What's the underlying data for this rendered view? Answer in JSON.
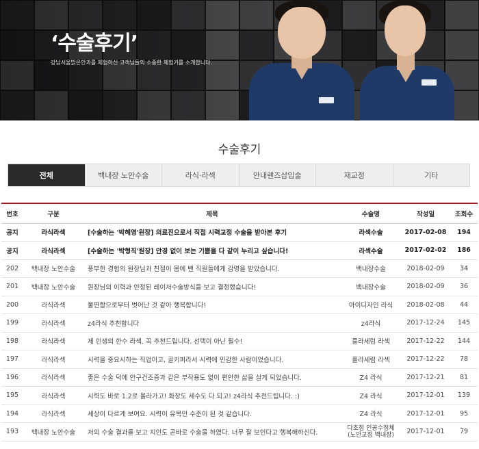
{
  "banner": {
    "title": "‘수술후기’",
    "subtitle": "강남서울밝은안과를 체험하신 고객님들의 소중한 체험기를 소개합니다."
  },
  "page_title": "수술후기",
  "tabs": [
    {
      "label": "전체",
      "active": true
    },
    {
      "label": "백내장 노안수술",
      "active": false
    },
    {
      "label": "라식·라섹",
      "active": false
    },
    {
      "label": "안내렌즈삽입술",
      "active": false
    },
    {
      "label": "재교정",
      "active": false
    },
    {
      "label": "기타",
      "active": false
    }
  ],
  "table": {
    "headers": {
      "no": "번호",
      "category": "구분",
      "title": "제목",
      "surgery": "수술명",
      "date": "작성일",
      "views": "조회수"
    },
    "rows": [
      {
        "no": "공지",
        "category": "라식라섹",
        "title": "[수술하는 '박혜영'원장] 의료진으로서 직접 시력교정 수술을 받아본 후기",
        "surgery": "라섹수술",
        "surgery2": "",
        "date": "2017-02-08",
        "views": "194",
        "notice": true
      },
      {
        "no": "공지",
        "category": "라식라섹",
        "title": "[수술하는 '박형직'원장] 안경 없이 보는 기쁨을 다 같이 누리고 싶습니다!",
        "surgery": "라섹수술",
        "surgery2": "",
        "date": "2017-02-02",
        "views": "186",
        "notice": true
      },
      {
        "no": "202",
        "category": "백내장 노안수술",
        "title": "풍부한 경험의 원장님과 친절이 몸에 밴 직원들에게 감명을 받았습니다.",
        "surgery": "백내장수술",
        "surgery2": "",
        "date": "2018-02-09",
        "views": "34",
        "notice": false
      },
      {
        "no": "201",
        "category": "백내장 노안수술",
        "title": "원장님의 이력과 안정된 레이저수술방식을 보고 결정했습니다!",
        "surgery": "백내장수술",
        "surgery2": "",
        "date": "2018-02-09",
        "views": "36",
        "notice": false
      },
      {
        "no": "200",
        "category": "라식라섹",
        "title": "불편함으로부터 벗어난 것 같아 행복합니다!",
        "surgery": "아이디자인 라식",
        "surgery2": "",
        "date": "2018-02-08",
        "views": "44",
        "notice": false
      },
      {
        "no": "199",
        "category": "라식라섹",
        "title": "z4라식 추천합니다",
        "surgery": "z4라식",
        "surgery2": "",
        "date": "2017-12-24",
        "views": "145",
        "notice": false
      },
      {
        "no": "198",
        "category": "라식라섹",
        "title": "제 인생의 한수 라섹. 꼭 추천드립니다. 선택이 아닌 필수!",
        "surgery": "플라세럼 라섹",
        "surgery2": "",
        "date": "2017-12-22",
        "views": "144",
        "notice": false
      },
      {
        "no": "197",
        "category": "라식라섹",
        "title": "시력을 중요시하는 직업이고, 골키퍼라서 시력에 민감한 사람이었습니다.",
        "surgery": "플라세럼 라섹",
        "surgery2": "",
        "date": "2017-12-22",
        "views": "78",
        "notice": false
      },
      {
        "no": "196",
        "category": "라식라섹",
        "title": "좋은 수술 덕에 안구건조증과 같은 부작용도 없이 편안한 삶을 살게 되었습니다.",
        "surgery": "Z4 라식",
        "surgery2": "",
        "date": "2017-12-21",
        "views": "81",
        "notice": false
      },
      {
        "no": "195",
        "category": "라식라섹",
        "title": "시력도 바로 1.2로 올라가고! 화장도 세수도 다 되고! z4라식 추천드립니다. :)",
        "surgery": "Z4 라식",
        "surgery2": "",
        "date": "2017-12-01",
        "views": "139",
        "notice": false
      },
      {
        "no": "194",
        "category": "라식라섹",
        "title": "세상이 다르게 보여요. 시력이 유목민 수준이 된 것 같습니다.",
        "surgery": "Z4 라식",
        "surgery2": "",
        "date": "2017-12-01",
        "views": "95",
        "notice": false
      },
      {
        "no": "193",
        "category": "백내장 노안수술",
        "title": "저의 수술 결과를 보고 지인도 곧바로 수술을 하였다. 너무 잘 보인다고 행복해하신다.",
        "surgery": "다초점 인공수정체",
        "surgery2": "(노안교정 백내장)",
        "date": "2017-12-01",
        "views": "79",
        "notice": false
      }
    ]
  },
  "colors": {
    "accent": "#a31c24",
    "active_tab": "#2a2a2a",
    "scrub": "#1f3a66"
  }
}
